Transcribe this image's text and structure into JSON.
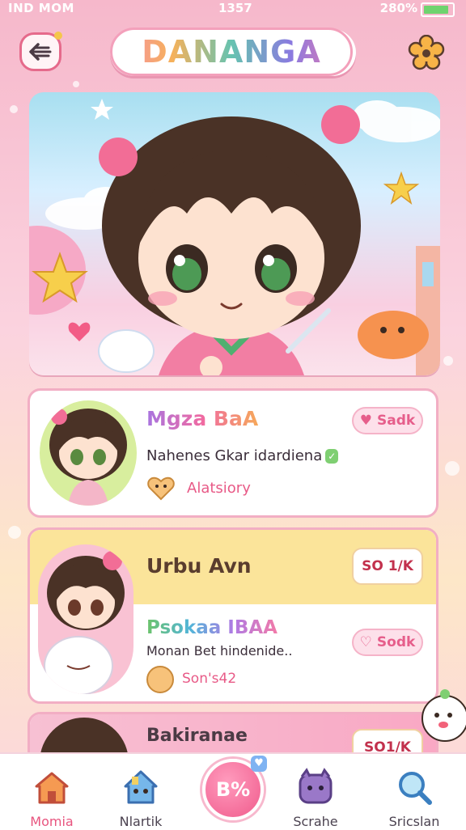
{
  "status_bar": {
    "carrier": "IND MOM",
    "time": "1357",
    "battery": "280%"
  },
  "header": {
    "logo_text": "DANANGA"
  },
  "cards": [
    {
      "title": "Mgza BaA",
      "subtitle": "Nahenes Gkar idardiena",
      "meta": "Alatsiory",
      "action": "Sadk"
    },
    {
      "title": "Urbu Avn",
      "badge": "SO 1/K",
      "subtitle_title": "Psokaa IBAA",
      "subtitle": "Monan Bet hindenide..",
      "meta": "Son's42",
      "action": "Sodk"
    },
    {
      "title": "Bakiranae",
      "badge": "SO1/K"
    }
  ],
  "nav": [
    {
      "label": "Momia",
      "icon": "home-icon"
    },
    {
      "label": "Nlartik",
      "icon": "house-icon"
    },
    {
      "label": "B%",
      "icon": "center-action",
      "badge": "♥"
    },
    {
      "label": "Scrahe",
      "icon": "monster-icon"
    },
    {
      "label": "Sricslan",
      "icon": "search-icon"
    }
  ],
  "colors": {
    "accent": "#e8557f",
    "pink": "#f7c6d6",
    "yellow_band": "#fbe49a"
  }
}
